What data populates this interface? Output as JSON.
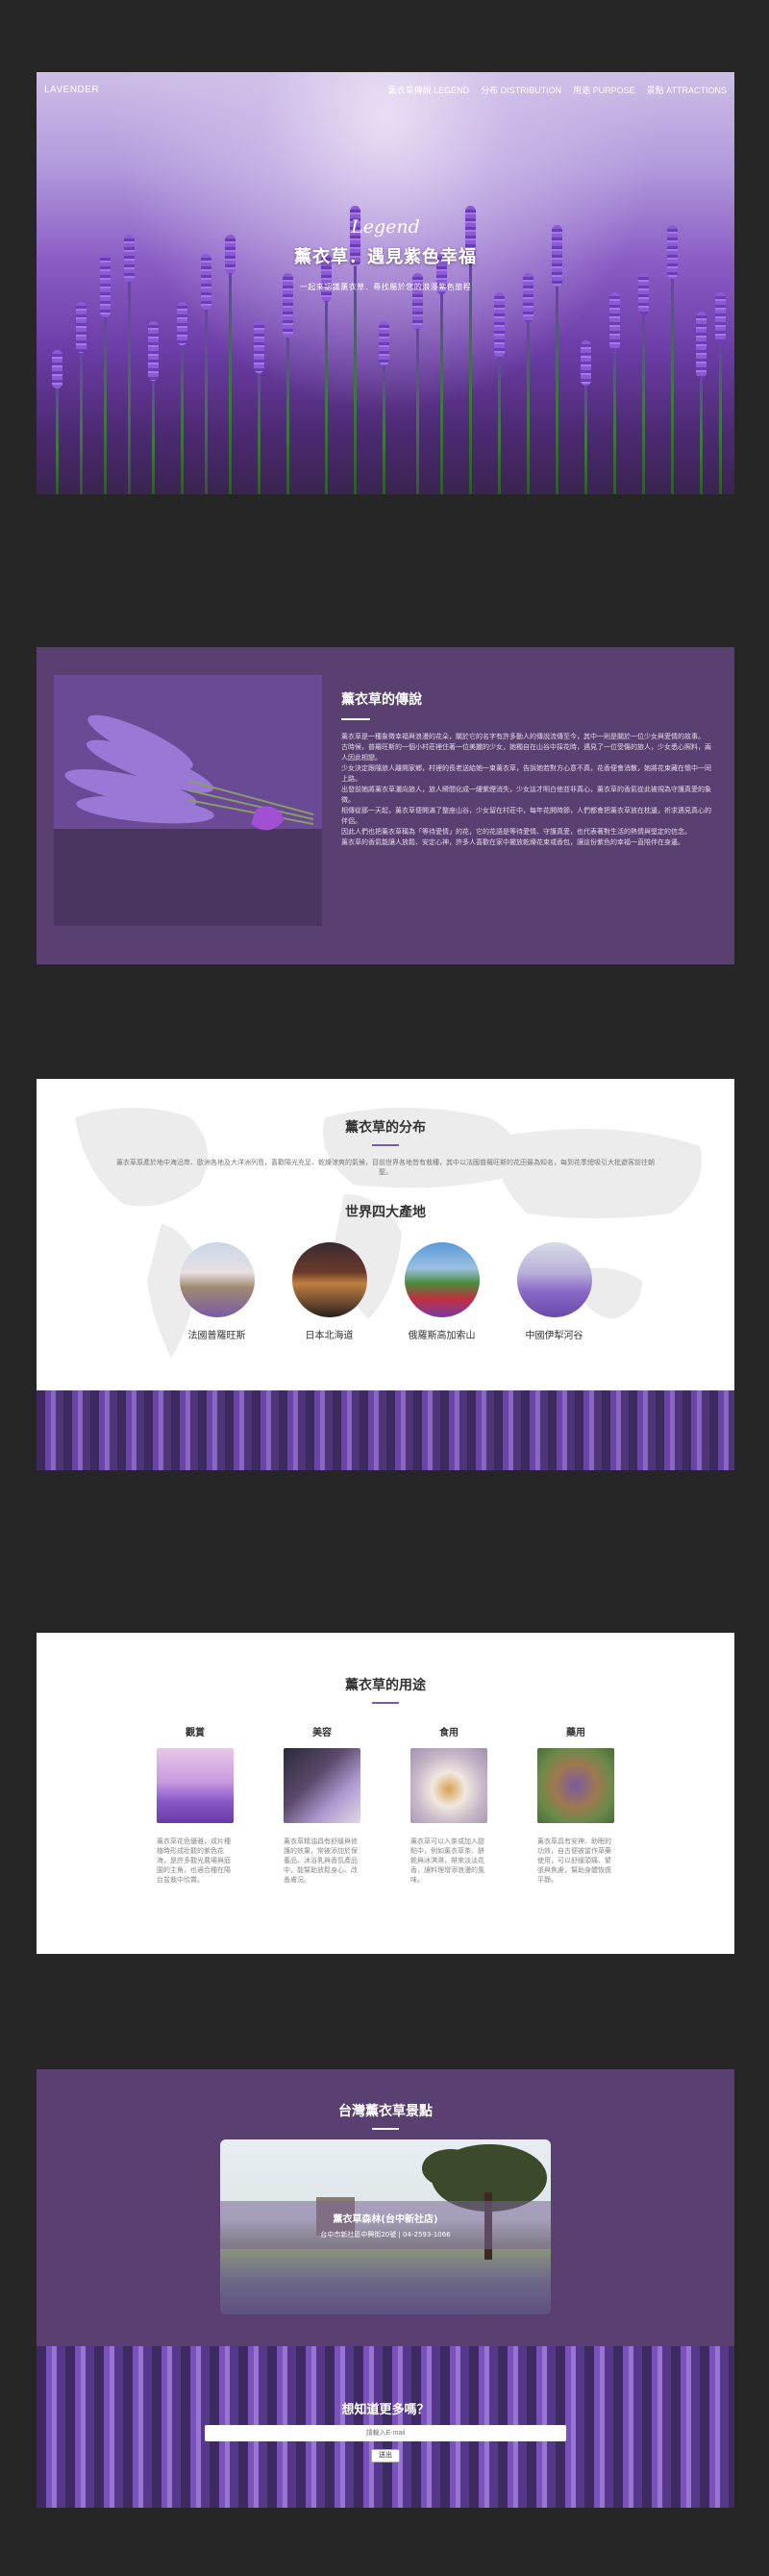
{
  "hero": {
    "logo": "LAVENDER",
    "nav": [
      "薰衣草傳說 LEGEND",
      "分布 DISTRIBUTION",
      "用途 PURPOSE",
      "景點 ATTRACTIONS"
    ],
    "script": "Legend",
    "title": "薰衣草．遇見紫色幸福",
    "subtitle": "一起來認識薰衣草．尋找屬於您的浪漫紫色旅程"
  },
  "legend": {
    "title": "薰衣草的傳說",
    "paragraphs": [
      "薰衣草是一種象徵幸福與浪漫的花朵，關於它的名字有許多動人的傳說流傳至今，其中一則是關於一位少女與愛情的故事。",
      "古時候，普羅旺斯的一個小村莊裡住著一位美麗的少女，她獨自在山谷中採花時，遇見了一位受傷的旅人，少女悉心照料，兩人因此相戀。",
      "少女決定跟隨旅人離開家鄉，村裡的長老送給她一束薰衣草，告訴她若對方心意不真，花香便會消散，她將花束藏在懷中一同上路。",
      "出發前她將薰衣草灑向旅人，旅人瞬間化成一縷紫煙消失，少女這才明白他並非真心，薰衣草的香氣從此被視為守護真愛的象徵。",
      "相傳從那一天起，薰衣草便開滿了整座山谷，少女留在村莊中，每年花開時節，人們都會把薰衣草放在枕邊，祈求遇見真心的伴侶。",
      "因此人們也把薰衣草稱為「等待愛情」的花，它的花語是等待愛情、守護真愛，也代表著對生活的熱情與堅定的信念。",
      "薰衣草的香氣能讓人放鬆、安定心神，許多人喜歡在家中擺放乾燥花束或香包，讓這份紫色的幸福一直陪伴在身邊。"
    ]
  },
  "dist": {
    "title": "薰衣草的分布",
    "desc": "薰衣草原產於地中海沿岸、歐洲各地及大洋洲列島，喜歡陽光充足、乾燥涼爽的氣候，目前世界各地皆有栽種，其中以法國普羅旺斯的花田最為知名，每到花季總吸引大批遊客前往朝聖。",
    "subtitle": "世界四大產地",
    "places": [
      "法國普羅旺斯",
      "日本北海道",
      "俄羅斯高加索山",
      "中國伊犁河谷"
    ]
  },
  "uses": {
    "title": "薰衣草的用途",
    "cols": [
      {
        "h": "觀賞",
        "p": "薰衣草花色優雅，成片種植時形成壯觀的紫色花海，是許多觀光農場與庭園的主角，也適合種在陽台盆栽中欣賞。"
      },
      {
        "h": "美容",
        "p": "薰衣草精油具有舒緩與修護的效果，常被添加於保養品、沐浴乳與香氛產品中，能幫助放鬆身心、改善膚況。"
      },
      {
        "h": "食用",
        "p": "薰衣草可以入茶或加入甜點中，例如薰衣草茶、餅乾與冰淇淋，帶來淡淡花香，讓料理增添浪漫的風味。"
      },
      {
        "h": "藥用",
        "p": "薰衣草具有安神、助眠的功效，自古便被當作草藥使用，可以舒緩頭痛、緊張與焦慮，幫助身體恢復平靜。"
      }
    ]
  },
  "spots": {
    "title": "台灣薰衣草景點",
    "name": "薰衣草森林(台中新社店)",
    "addr": "台中市新社區中興街20號 | 04-2593-1066",
    "sub_title": "想知道更多嗎？",
    "email_placeholder": "請輸入E-mail",
    "button": "送出"
  },
  "colors": {
    "brand_purple": "#5a4070",
    "page_bg": "#262626",
    "accent": "#7a5ca6"
  }
}
